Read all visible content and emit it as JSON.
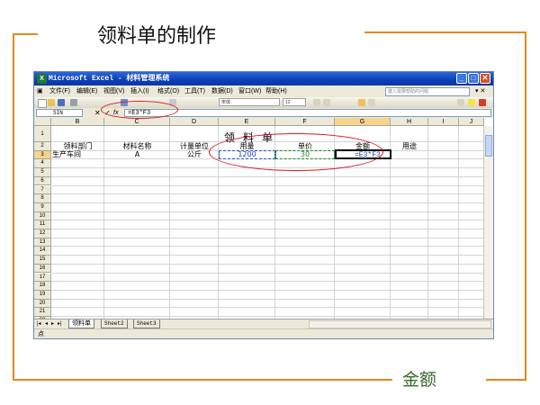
{
  "slide": {
    "title": "领料单的制作",
    "caption": "金额",
    "accent_color": "#e28a1e"
  },
  "window": {
    "title": "Microsoft Excel - 材料管理系统",
    "buttons": [
      "minimize",
      "maximize",
      "close"
    ]
  },
  "menu": {
    "items": [
      "文件(F)",
      "编辑(E)",
      "视图(V)",
      "插入(I)",
      "格式(O)",
      "工具(T)",
      "数据(D)",
      "窗口(W)",
      "帮助(H)"
    ],
    "help_placeholder": "键入需要帮助的问题"
  },
  "toolbar": {
    "font_box": "宋体",
    "size_box": "12"
  },
  "formula_bar": {
    "name_box": "SIN",
    "cancel": "✕",
    "enter": "✓",
    "fx": "fx",
    "formula": "=E3*F3"
  },
  "sheet": {
    "columns": [
      "B",
      "C",
      "D",
      "E",
      "F",
      "G",
      "H",
      "I",
      "J"
    ],
    "active_column": "G",
    "rows": [
      "1",
      "2",
      "3",
      "4",
      "5",
      "6",
      "7",
      "8",
      "9",
      "10",
      "11",
      "12",
      "13",
      "14",
      "15",
      "16",
      "17",
      "18",
      "19",
      "20",
      "21",
      "22"
    ],
    "active_row": "3",
    "title": "领料单",
    "headers": [
      "领料部门",
      "材料名称",
      "计量单位",
      "用量",
      "单价",
      "金额",
      "用途"
    ],
    "row3": {
      "department": "生产车间",
      "material": "A",
      "unit": "公斤",
      "quantity": "1200",
      "price": "30",
      "amount_formula": "=E3*F3"
    }
  },
  "tabs": {
    "items": [
      "领料单",
      "Sheet2",
      "Sheet3"
    ],
    "active": "领料单"
  },
  "status": {
    "mode": "点"
  }
}
